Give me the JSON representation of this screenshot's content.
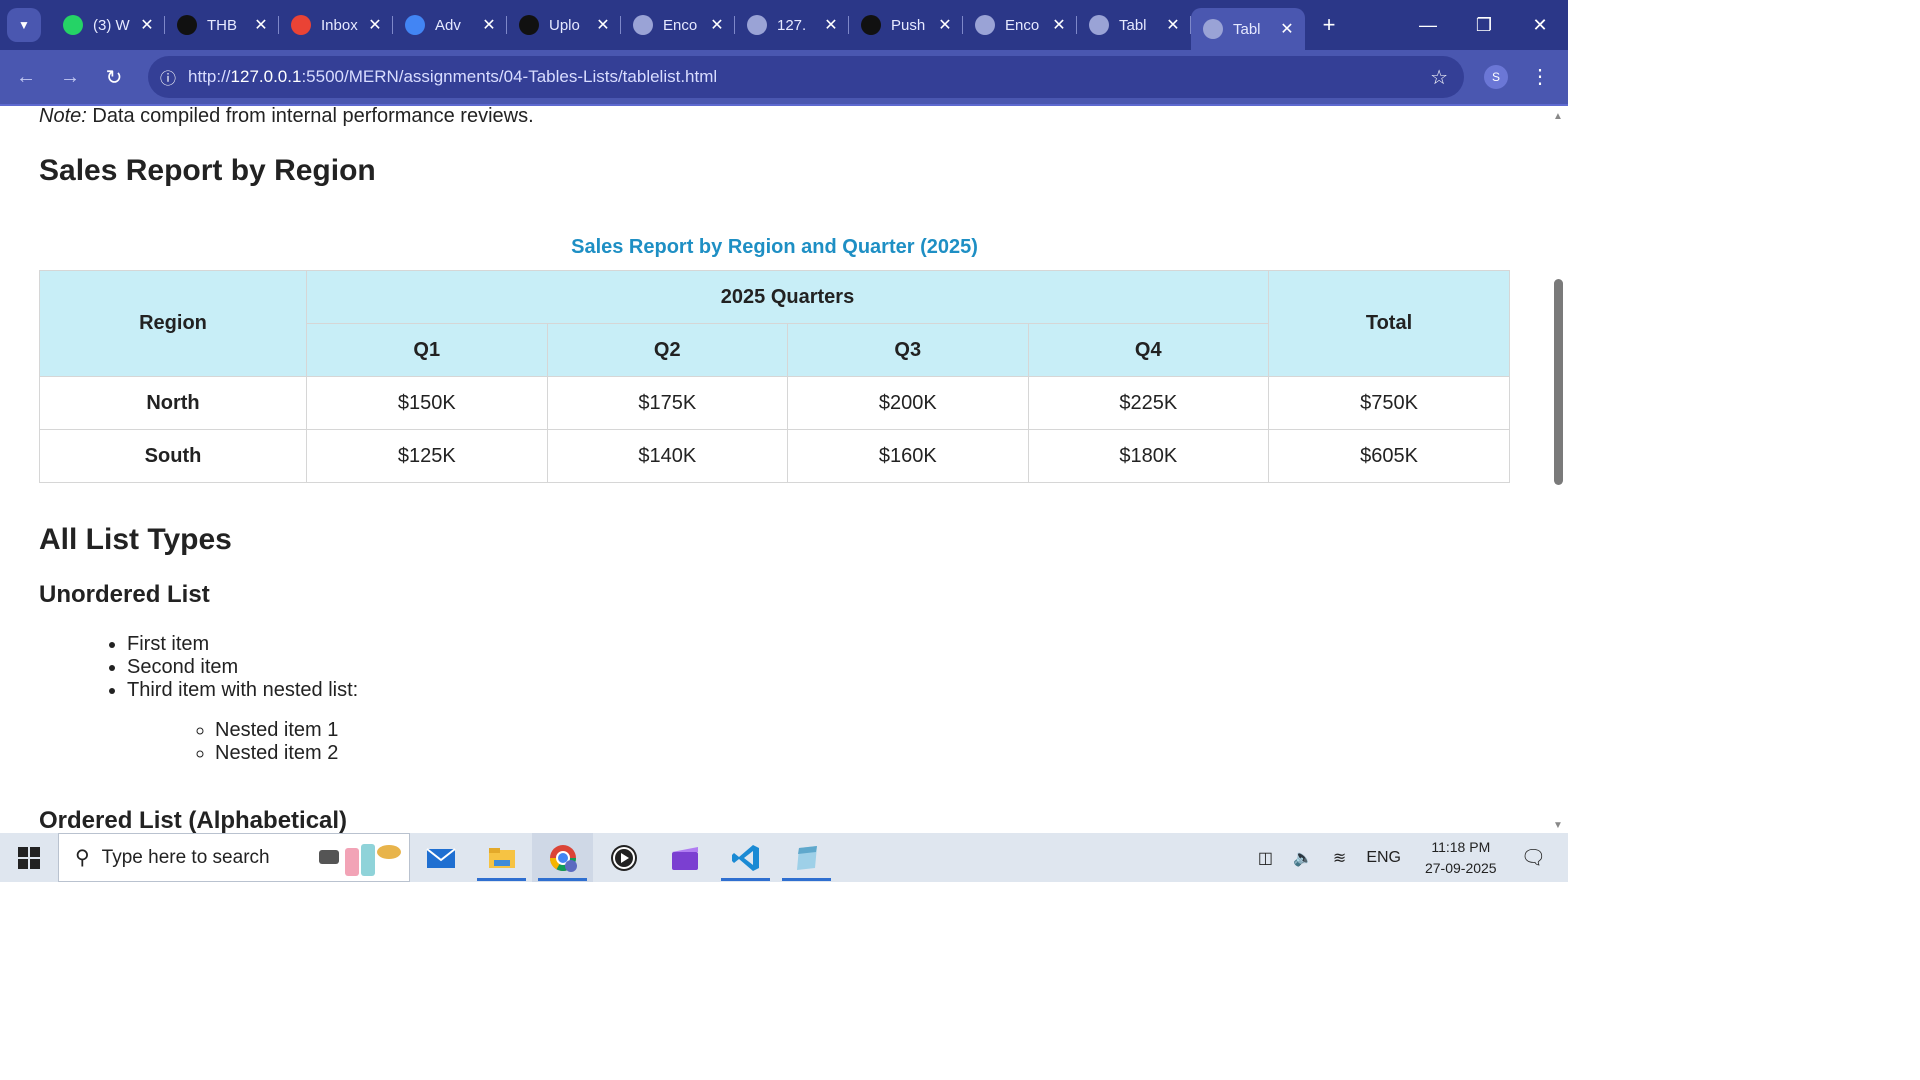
{
  "browser": {
    "tabs": [
      {
        "label": "(3) W",
        "icon": "whatsapp-icon",
        "color": "#25d366"
      },
      {
        "label": "THB",
        "icon": "github-icon",
        "color": "#111111"
      },
      {
        "label": "Inbox",
        "icon": "gmail-icon",
        "color": "#ea4335"
      },
      {
        "label": "Adv",
        "icon": "docs-icon",
        "color": "#4285f4"
      },
      {
        "label": "Uplo",
        "icon": "github-icon",
        "color": "#111111"
      },
      {
        "label": "Enco",
        "icon": "globe-icon",
        "color": "#9aa3d6"
      },
      {
        "label": "127.",
        "icon": "globe-icon",
        "color": "#9aa3d6"
      },
      {
        "label": "Push",
        "icon": "openai-icon",
        "color": "#111111"
      },
      {
        "label": "Enco",
        "icon": "globe-icon",
        "color": "#9aa3d6"
      },
      {
        "label": "Tabl",
        "icon": "globe-icon",
        "color": "#9aa3d6"
      },
      {
        "label": "Tabl",
        "icon": "globe-icon",
        "color": "#9aa3d6",
        "active": true
      }
    ],
    "url_host": "127.0.0.1",
    "url_prefix": "http://",
    "url_path": ":5500/MERN/assignments/04-Tables-Lists/tablelist.html",
    "profile_initial": "S"
  },
  "page": {
    "note_label": "Note:",
    "note_text": " Data compiled from internal performance reviews.",
    "section_title": "Sales Report by Region",
    "table_caption": "Sales Report by Region and Quarter (2025)",
    "table": {
      "region_header": "Region",
      "group_header": "2025 Quarters",
      "quarters": [
        "Q1",
        "Q2",
        "Q3",
        "Q4"
      ],
      "total_header": "Total",
      "rows": [
        {
          "region": "North",
          "values": [
            "$150K",
            "$175K",
            "$200K",
            "$225K"
          ],
          "total": "$750K"
        },
        {
          "region": "South",
          "values": [
            "$125K",
            "$140K",
            "$160K",
            "$180K"
          ],
          "total": "$605K"
        }
      ]
    },
    "lists_title": "All List Types",
    "unordered_title": "Unordered List",
    "unordered_items": [
      "First item",
      "Second item",
      "Third item with nested list:"
    ],
    "nested_items": [
      "Nested item 1",
      "Nested item 2"
    ],
    "ordered_title": "Ordered List (Alphabetical)"
  },
  "taskbar": {
    "search_placeholder": "Type here to search",
    "apps": [
      "mail-icon",
      "file-explorer-icon",
      "chrome-icon",
      "media-player-icon",
      "clipchamp-icon",
      "vscode-icon",
      "notepad-icon"
    ],
    "language": "ENG",
    "time": "11:18 PM",
    "date": "27-09-2025"
  }
}
